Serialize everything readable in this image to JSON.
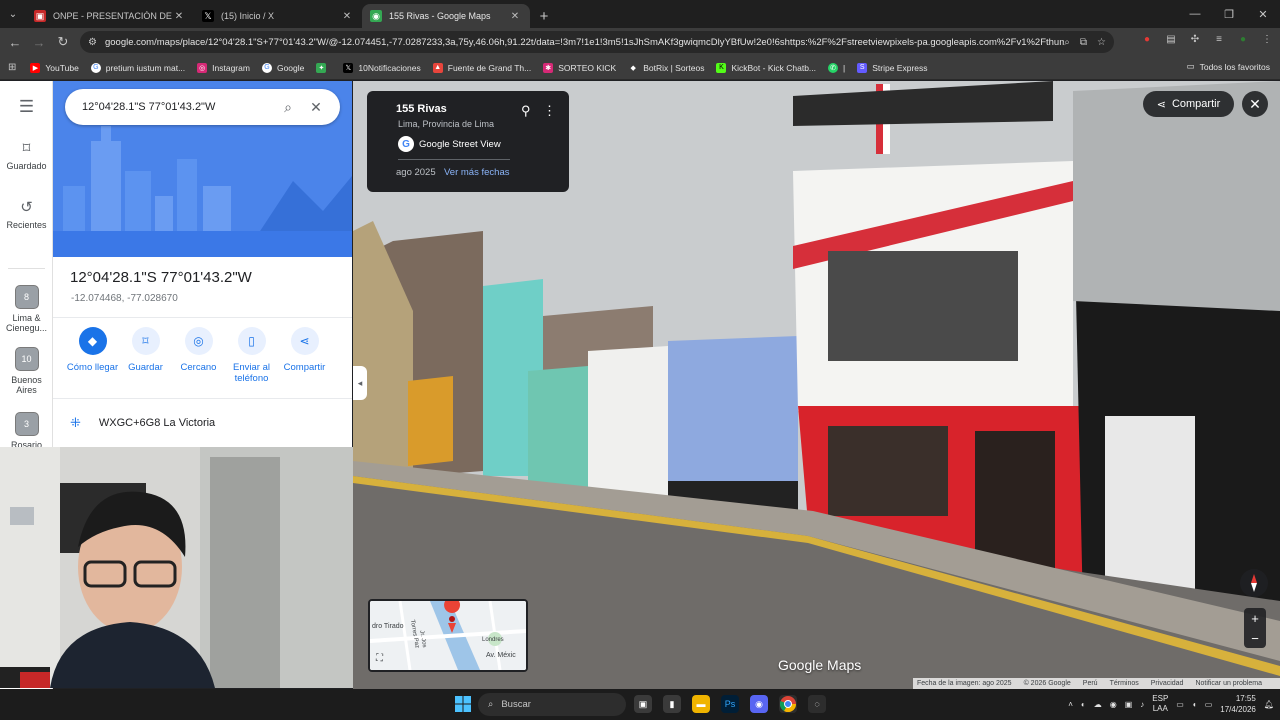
{
  "browser": {
    "tabs": [
      {
        "title": "ONPE - PRESENTACIÓN DE RES",
        "favicon": "onpe-icon",
        "active": false
      },
      {
        "title": "(15) Inicio / X",
        "favicon": "x-icon",
        "active": false
      },
      {
        "title": "155 Rivas - Google Maps",
        "favicon": "maps-icon",
        "active": true
      }
    ],
    "url": "google.com/maps/place/12°04'28.1\"S+77°01'43.2\"W/@-12.074451,-77.0287233,3a,75y,46.06h,91.22t/data=!3m7!1e1!3m5!1sJhSmAKf3gwiqmcDlyYBfUw!2e0!6shttps:%2F%2Fstreetviewpixels-pa.googleapis.com%2Fv1%2Fthumb...",
    "bookmarks": [
      {
        "label": "YouTube",
        "icon": "youtube-icon",
        "color": "#ff0000"
      },
      {
        "label": "pretium iustum mat...",
        "icon": "google-icon",
        "color": "#4285f4"
      },
      {
        "label": "Instagram",
        "icon": "instagram-icon",
        "color": "#d62976"
      },
      {
        "label": "Google",
        "icon": "google-icon",
        "color": "#4285f4"
      },
      {
        "label": "",
        "icon": "pinwheel-icon",
        "color": "#34a853"
      },
      {
        "label": "10Notificaciones",
        "icon": "x-icon",
        "color": "#000000"
      },
      {
        "label": "Fuente de Grand Th...",
        "icon": "flame-icon",
        "color": "#e8453c"
      },
      {
        "label": "SORTEO KICK",
        "icon": "kick-icon",
        "color": "#d62976"
      },
      {
        "label": "BotRix | Sorteos",
        "icon": "diamond-icon",
        "color": "#ffffff"
      },
      {
        "label": "KickBot - Kick Chatb...",
        "icon": "kick-icon",
        "color": "#53fc18"
      },
      {
        "label": "|",
        "icon": "whatsapp-icon",
        "color": "#25d366"
      },
      {
        "label": "Stripe Express",
        "icon": "stripe-icon",
        "color": "#635bff"
      }
    ],
    "bookmarks_all": "Todos los favoritos"
  },
  "maps": {
    "search_query": "12°04'28.1\"S 77°01'43.2\"W",
    "rail": {
      "saved": "Guardado",
      "recent": "Recientes",
      "thumbs": [
        {
          "badge": "8",
          "label": "Lima & Cienegu..."
        },
        {
          "badge": "10",
          "label": "Buenos Aires"
        },
        {
          "badge": "3",
          "label": "Rosario"
        }
      ]
    },
    "place": {
      "title": "12°04'28.1\"S 77°01'43.2\"W",
      "coords": "-12.074468, -77.028670",
      "plus_code": "WXGC+6G8 La Victoria"
    },
    "actions": [
      {
        "label": "Cómo llegar",
        "icon": "directions-icon"
      },
      {
        "label": "Guardar",
        "icon": "bookmark-icon"
      },
      {
        "label": "Cercano",
        "icon": "nearby-icon"
      },
      {
        "label": "Enviar al teléfono",
        "icon": "phone-icon"
      },
      {
        "label": "Compartir",
        "icon": "share-icon"
      }
    ],
    "streetview": {
      "title": "155 Rivas",
      "subtitle": "Lima, Provincia de Lima",
      "source": "Google Street View",
      "date": "ago 2025",
      "more_dates": "Ver más fechas",
      "share": "Compartir",
      "logo": "Google Maps",
      "footer": [
        "Fecha de la imagen: ago 2025",
        "© 2026 Google",
        "Perú",
        "Términos",
        "Privacidad",
        "Notificar un problema"
      ],
      "minimap_labels": [
        "dro Tirado",
        "Torres Paz",
        "Jr. Jos",
        "Londres",
        "Av. Méxic"
      ]
    }
  },
  "taskbar": {
    "search": "Buscar",
    "lang": "ESP",
    "lang2": "LAA",
    "time": "17:55",
    "date": "17/4/2026"
  }
}
